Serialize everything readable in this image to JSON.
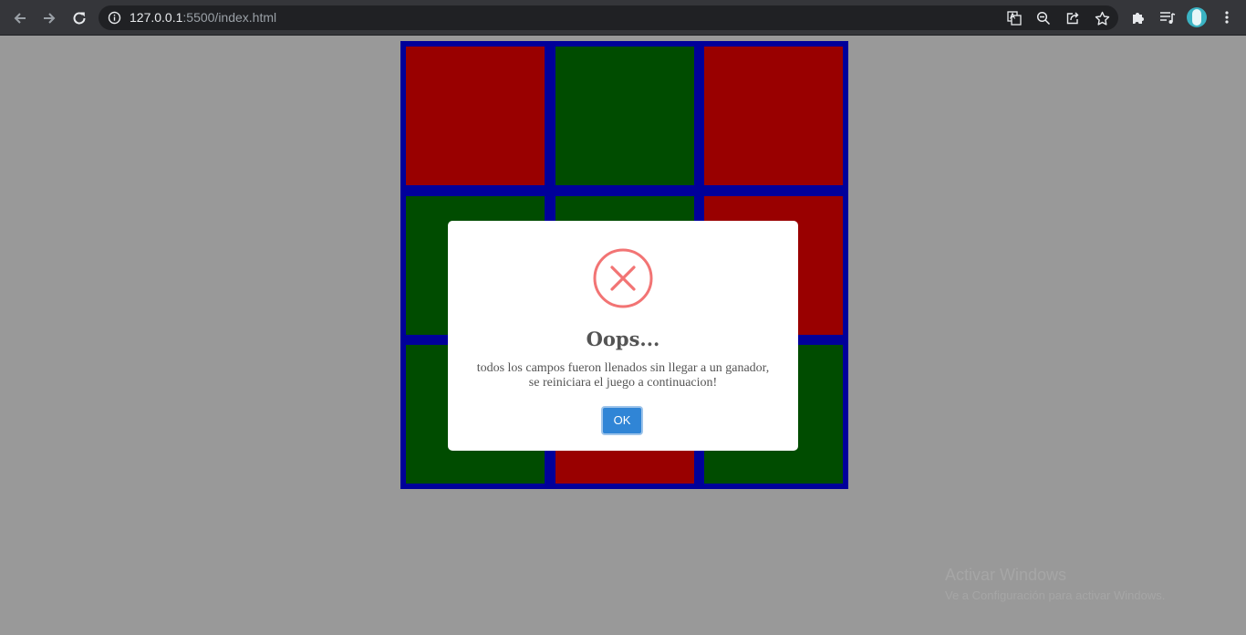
{
  "browser": {
    "url_host": "127.0.0.1",
    "url_rest": ":5500/index.html",
    "icons": {
      "back": "arrow-left-icon",
      "forward": "arrow-right-icon",
      "reload": "reload-icon",
      "site_info": "info-icon",
      "translate": "translate-icon",
      "zoom": "zoom-out-icon",
      "share": "share-icon",
      "bookmark": "star-icon",
      "extensions": "puzzle-icon",
      "media": "playlist-icon",
      "profile": "avatar",
      "menu": "kebab-menu-icon"
    }
  },
  "board": {
    "colors": {
      "border": "#00009a",
      "red": "#990000",
      "green": "#004c00"
    },
    "cells": [
      "red",
      "green",
      "red",
      "green",
      "green",
      "red",
      "green",
      "red",
      "green"
    ]
  },
  "dialog": {
    "icon": "error-x-icon",
    "icon_color": "#f27474",
    "title": "Oops...",
    "text_line1": "todos los campos fueron llenados sin llegar a un ganador,",
    "text_line2": "se reiniciara el juego a continuacion!",
    "ok_label": "OK",
    "ok_color": "#3085d6"
  },
  "watermark": {
    "title": "Activar Windows",
    "subtitle": "Ve a Configuración para activar Windows."
  }
}
